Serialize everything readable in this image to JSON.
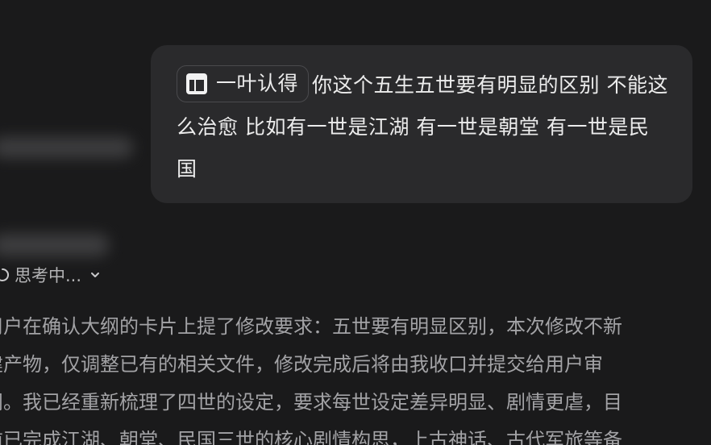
{
  "user_message": {
    "chip": {
      "icon": "table-layout-icon",
      "label": "一叶认得"
    },
    "text": "你这个五生五世要有明显的区别 不能这么治愈 比如有一世是江湖 有一世是朝堂 有一世是民国"
  },
  "assistant": {
    "status": {
      "label": "思考中...",
      "icon": "spinner-icon",
      "toggle_icon": "chevron-down-icon"
    },
    "reasoning_lines": [
      "用户在确认大纲的卡片上提了修改要求：五世要有明显区别，本次修改不新",
      "建产物，仅调整已有的相关文件，修改完成后将由我收口并提交给用户审",
      "阅。我已经重新梳理了四世的设定，要求每世设定差异明显、剧情更虐，目",
      "前已完成江湖、朝堂、民国三世的核心剧情构思，上古神话、古代军旅等备"
    ]
  },
  "colors": {
    "background": "#1a1a1b",
    "bubble": "#2a2a2c",
    "text_primary": "#ececec",
    "text_secondary": "#a3a3a6"
  }
}
